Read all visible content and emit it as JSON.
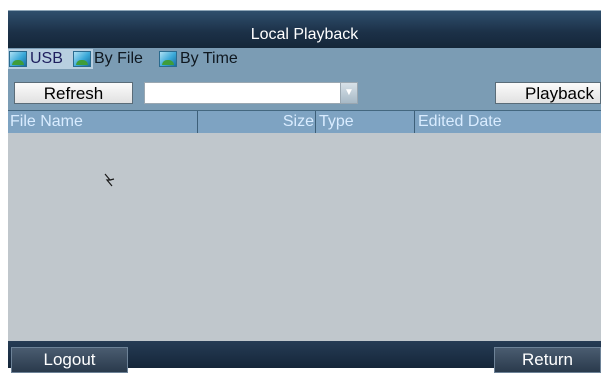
{
  "window": {
    "title": "Local Playback"
  },
  "tabs": [
    {
      "label": "USB",
      "icon": "usb-device-icon",
      "active": true
    },
    {
      "label": "By File",
      "icon": "file-device-icon",
      "active": false
    },
    {
      "label": "By Time",
      "icon": "time-device-icon",
      "active": false
    }
  ],
  "toolbar": {
    "refresh_label": "Refresh",
    "device_select_value": "",
    "playback_label": "Playback"
  },
  "table": {
    "columns": [
      "File Name",
      "Size",
      "Type",
      "Edited Date"
    ],
    "rows": []
  },
  "footer": {
    "logout_label": "Logout",
    "return_label": "Return"
  },
  "colors": {
    "titlebar": "#1c3148",
    "toolbar": "#7b9cb4",
    "header": "#7ea3c2",
    "list_background": "#c0c7cc",
    "active_tab": "#b8cfe0"
  }
}
